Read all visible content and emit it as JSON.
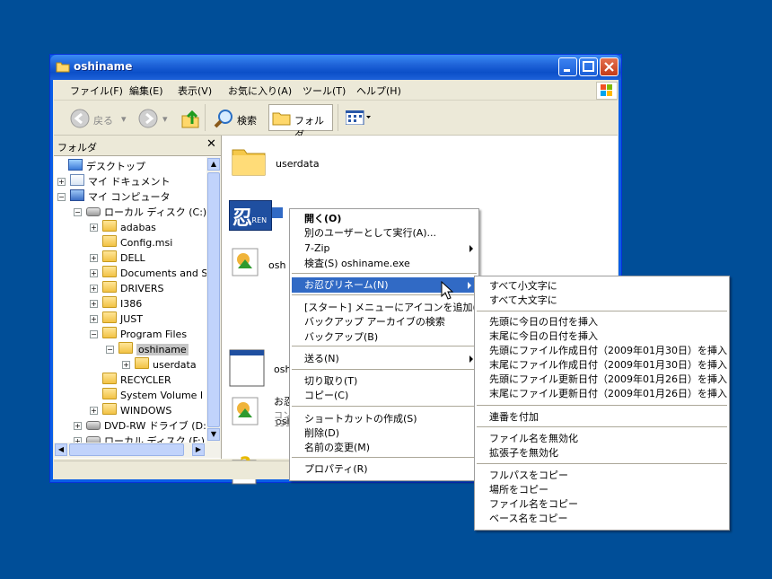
{
  "window": {
    "title": "oshiname"
  },
  "menubar": [
    "ファイル(F)",
    "編集(E)",
    "表示(V)",
    "お気に入り(A)",
    "ツール(T)",
    "ヘルプ(H)"
  ],
  "toolbar": {
    "back": "戻る",
    "search": "検索",
    "folders": "フォルダ"
  },
  "folder_pane": {
    "title": "フォルダ",
    "tree": [
      {
        "label": "デスクトップ"
      },
      {
        "label": "マイ ドキュメント"
      },
      {
        "label": "マイ コンピュータ"
      },
      {
        "label": "ローカル ディスク (C:)"
      },
      {
        "label": "adabas"
      },
      {
        "label": "Config.msi"
      },
      {
        "label": "DELL"
      },
      {
        "label": "Documents and S"
      },
      {
        "label": "DRIVERS"
      },
      {
        "label": "I386"
      },
      {
        "label": "JUST"
      },
      {
        "label": "Program Files"
      },
      {
        "label": "oshiname"
      },
      {
        "label": "userdata"
      },
      {
        "label": "RECYCLER"
      },
      {
        "label": "System Volume I"
      },
      {
        "label": "WINDOWS"
      },
      {
        "label": "DVD-RW ドライブ (D:)"
      },
      {
        "label": "ローカル ディスク (F:)"
      }
    ]
  },
  "files": {
    "userdata": "userdata",
    "rename_icon_text": "忍",
    "rename_badge": ".REN",
    "osh": "osh",
    "help_prefix": "お忍",
    "help_line2": "コン",
    "help_line3": "199"
  },
  "context_menu": [
    {
      "label": "開く(O)"
    },
    {
      "label": "別のユーザーとして実行(A)..."
    },
    {
      "label": "7-Zip"
    },
    {
      "label": "検査(S) oshiname.exe"
    },
    {
      "label": "お忍びリネーム(N)"
    },
    {
      "label": "[スタート] メニューにアイコンを追加(I)"
    },
    {
      "label": "バックアップ アーカイブの検索"
    },
    {
      "label": "バックアップ(B)"
    },
    {
      "label": "送る(N)"
    },
    {
      "label": "切り取り(T)"
    },
    {
      "label": "コピー(C)"
    },
    {
      "label": "ショートカットの作成(S)"
    },
    {
      "label": "削除(D)"
    },
    {
      "label": "名前の変更(M)"
    },
    {
      "label": "プロパティ(R)"
    }
  ],
  "submenu": [
    {
      "label": "すべて小文字に"
    },
    {
      "label": "すべて大文字に"
    },
    {
      "label": "先頭に今日の日付を挿入"
    },
    {
      "label": "末尾に今日の日付を挿入"
    },
    {
      "label": "先頭にファイル作成日付（2009年01月30日）を挿入"
    },
    {
      "label": "末尾にファイル作成日付（2009年01月30日）を挿入"
    },
    {
      "label": "先頭にファイル更新日付（2009年01月26日）を挿入"
    },
    {
      "label": "末尾にファイル更新日付（2009年01月26日）を挿入"
    },
    {
      "label": "連番を付加"
    },
    {
      "label": "ファイル名を無効化"
    },
    {
      "label": "拡張子を無効化"
    },
    {
      "label": "フルパスをコピー"
    },
    {
      "label": "場所をコピー"
    },
    {
      "label": "ファイル名をコピー"
    },
    {
      "label": "ベース名をコピー"
    }
  ],
  "colors": {
    "desktop": "#004e98",
    "highlight": "#316ac5",
    "titlebar": "#0b4fc8"
  }
}
